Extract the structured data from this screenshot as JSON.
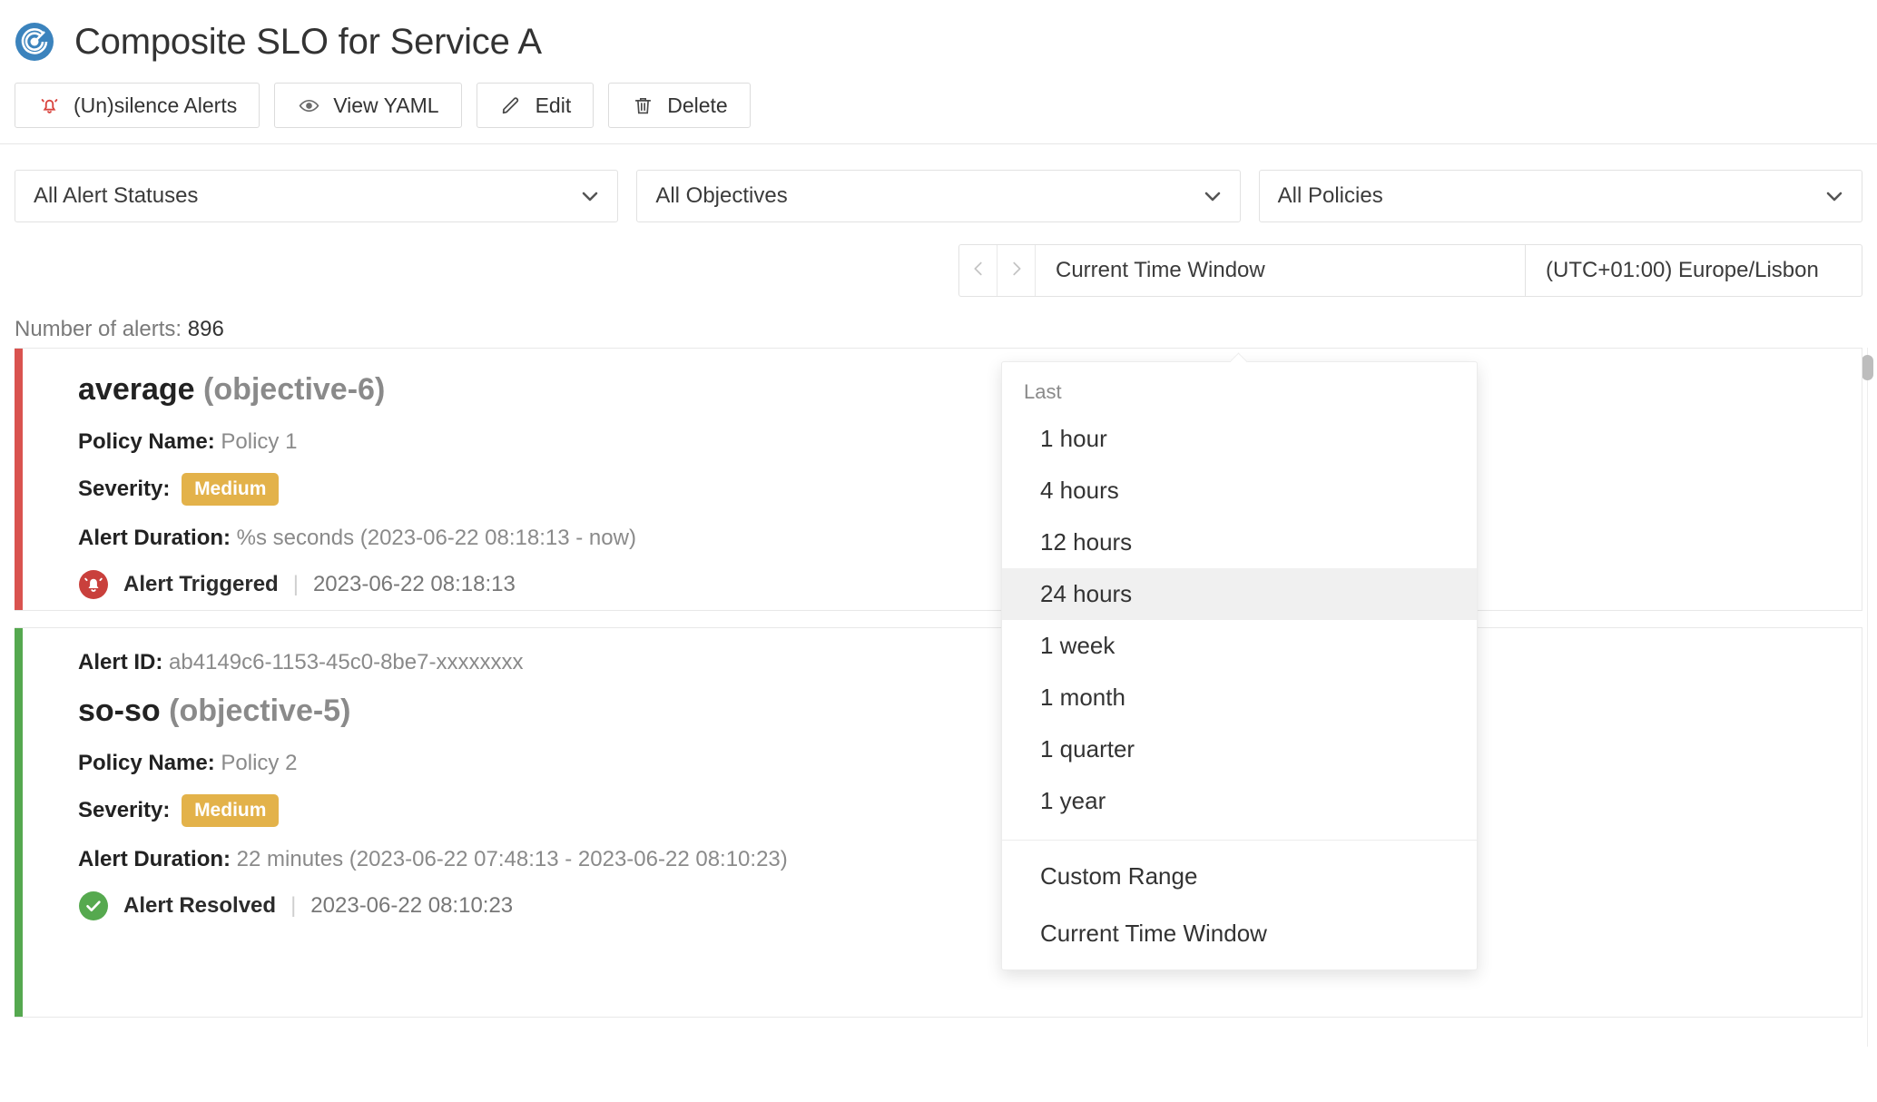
{
  "header": {
    "title": "Composite SLO for Service A",
    "logo_icon": "radar-target-icon"
  },
  "toolbar": {
    "buttons": [
      {
        "label": "(Un)silence Alerts",
        "icon": "bell-slash-icon",
        "icon_color": "#d9453f"
      },
      {
        "label": "View YAML",
        "icon": "eye-icon",
        "icon_color": "#6b6b6b"
      },
      {
        "label": "Edit",
        "icon": "pencil-icon",
        "icon_color": "#4a4a4a"
      },
      {
        "label": "Delete",
        "icon": "trash-icon",
        "icon_color": "#4a4a4a"
      }
    ]
  },
  "filters": [
    {
      "name": "alert-status",
      "value": "All Alert Statuses"
    },
    {
      "name": "objectives",
      "value": "All Objectives"
    },
    {
      "name": "policies",
      "value": "All Policies"
    }
  ],
  "time_window": {
    "prev_icon": "chevron-left-icon",
    "next_icon": "chevron-right-icon",
    "value": "Current Time Window",
    "timezone": "(UTC+01:00) Europe/Lisbon"
  },
  "time_dropdown": {
    "group_label": "Last",
    "items": [
      {
        "label": "1 hour",
        "active": false
      },
      {
        "label": "4 hours",
        "active": false
      },
      {
        "label": "12 hours",
        "active": false
      },
      {
        "label": "24 hours",
        "active": true
      },
      {
        "label": "1 week",
        "active": false
      },
      {
        "label": "1 month",
        "active": false
      },
      {
        "label": "1 quarter",
        "active": false
      },
      {
        "label": "1 year",
        "active": false
      }
    ],
    "bottom_items": [
      {
        "label": "Custom Range"
      },
      {
        "label": "Current Time Window"
      }
    ]
  },
  "alerts": {
    "count_label": "Number of alerts:",
    "count_value": "896",
    "labels": {
      "alert_id": "Alert ID:",
      "policy_name": "Policy Name:",
      "severity": "Severity:",
      "alert_duration": "Alert Duration:"
    },
    "items": [
      {
        "state": "triggered",
        "bar_color": "#d9534f",
        "alert_id": null,
        "name": "average",
        "objective": "(objective-6)",
        "policy_name": "Policy 1",
        "severity": "Medium",
        "severity_color": "#e3b24a",
        "duration": "%s seconds (2023-06-22 08:18:13 - now)",
        "status_icon": "alert-bell-icon",
        "status_text": "Alert Triggered",
        "status_time": "2023-06-22 08:18:13"
      },
      {
        "state": "resolved",
        "bar_color": "#55a84f",
        "alert_id": "ab4149c6-1153-45c0-8be7-xxxxxxxx",
        "name": "so-so",
        "objective": "(objective-5)",
        "policy_name": "Policy 2",
        "severity": "Medium",
        "severity_color": "#e3b24a",
        "duration": "22 minutes (2023-06-22 07:48:13 - 2023-06-22 08:10:23)",
        "status_icon": "check-circle-icon",
        "status_text": "Alert Resolved",
        "status_time": "2023-06-22 08:10:23"
      }
    ]
  }
}
